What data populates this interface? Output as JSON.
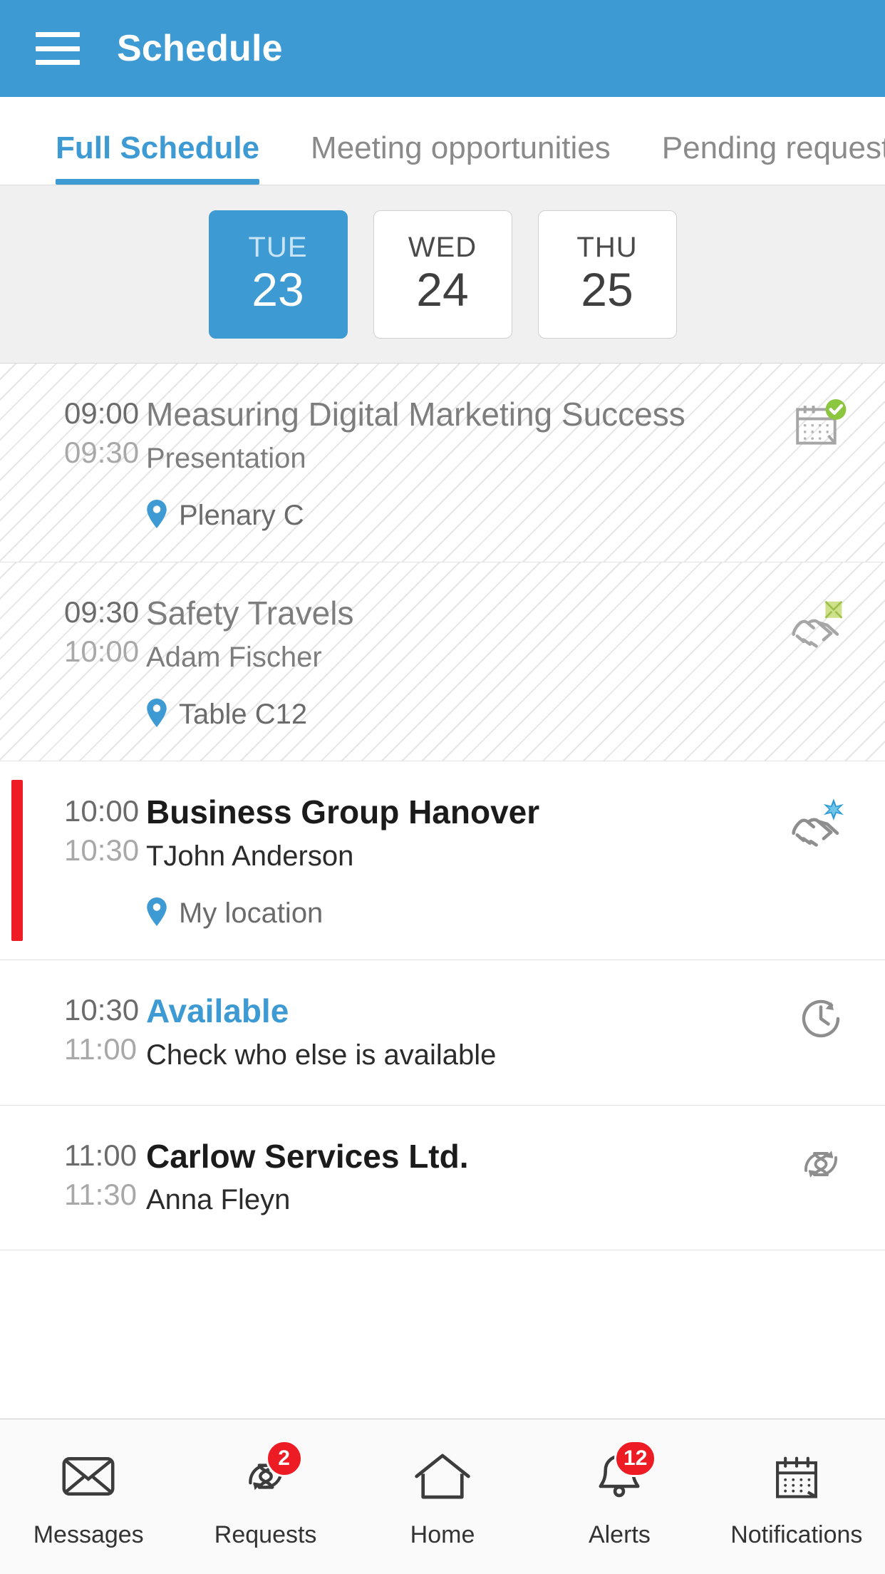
{
  "header": {
    "title": "Schedule",
    "menu_icon": "hamburger-menu-icon"
  },
  "tabs": [
    {
      "label": "Full Schedule",
      "active": true
    },
    {
      "label": "Meeting opportunities",
      "active": false
    },
    {
      "label": "Pending requests",
      "active": false
    }
  ],
  "date_selector": [
    {
      "dow": "TUE",
      "day": "23",
      "selected": true
    },
    {
      "dow": "WED",
      "day": "24",
      "selected": false
    },
    {
      "dow": "THU",
      "day": "25",
      "selected": false
    }
  ],
  "events": [
    {
      "start": "09:00",
      "end": "09:30",
      "title": "Measuring Digital Marketing Success",
      "subtitle": "Presentation",
      "location": "Plenary C",
      "icon": "calendar-check-icon",
      "style": "past",
      "has_accent": false
    },
    {
      "start": "09:30",
      "end": "10:00",
      "title": "Safety Travels",
      "subtitle": "Adam Fischer",
      "location": "Table C12",
      "icon": "handshake-envelope-icon",
      "style": "past",
      "has_accent": false
    },
    {
      "start": "10:00",
      "end": "10:30",
      "title": "Business Group Hanover",
      "subtitle": "TJohn Anderson",
      "location": "My location",
      "icon": "handshake-star-icon",
      "style": "current",
      "has_accent": true
    },
    {
      "start": "10:30",
      "end": "11:00",
      "title": "Available",
      "subtitle": "Check who else is available",
      "location": "",
      "icon": "clock-history-icon",
      "style": "available",
      "has_accent": false
    },
    {
      "start": "11:00",
      "end": "11:30",
      "title": "Carlow Services Ltd.",
      "subtitle": "Anna Fleyn",
      "location": "",
      "icon": "hourglass-refresh-icon",
      "style": "upcoming",
      "has_accent": false
    }
  ],
  "bottom_nav": [
    {
      "label": "Messages",
      "icon": "envelope-icon",
      "badge": ""
    },
    {
      "label": "Requests",
      "icon": "hourglass-refresh-icon",
      "badge": "2"
    },
    {
      "label": "Home",
      "icon": "home-icon",
      "badge": ""
    },
    {
      "label": "Alerts",
      "icon": "bell-icon",
      "badge": "12"
    },
    {
      "label": "Notifications",
      "icon": "calendar-icon",
      "badge": ""
    }
  ],
  "colors": {
    "accent_blue": "#3d9ad2",
    "badge_red": "#ed1c24",
    "current_bar_red": "#ee1c24",
    "green_check": "#8cc63f",
    "strip_gray": "#f0f0f0"
  }
}
